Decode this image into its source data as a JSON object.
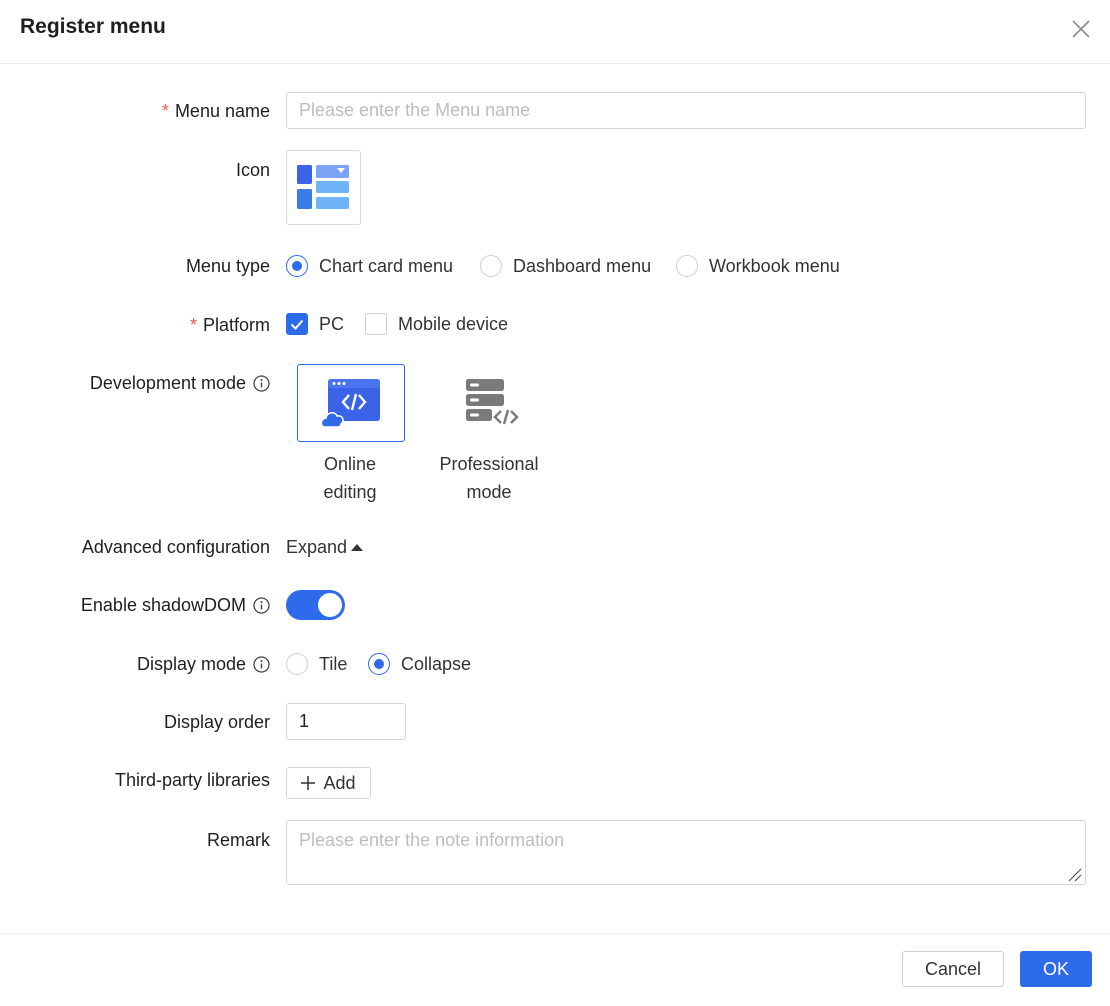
{
  "dialog": {
    "title": "Register menu"
  },
  "form": {
    "menu_name": {
      "label": "Menu name",
      "required_mark": "*",
      "value": "",
      "placeholder": "Please enter the Menu name"
    },
    "icon": {
      "label": "Icon",
      "icon_name": "table-layout-icon"
    },
    "menu_type": {
      "label": "Menu type",
      "options": [
        {
          "label": "Chart card menu",
          "selected": true
        },
        {
          "label": "Dashboard menu",
          "selected": false
        },
        {
          "label": "Workbook menu",
          "selected": false
        }
      ]
    },
    "platform": {
      "label": "Platform",
      "required_mark": "*",
      "options": [
        {
          "label": "PC",
          "checked": true
        },
        {
          "label": "Mobile device",
          "checked": false
        }
      ]
    },
    "development_mode": {
      "label": "Development mode",
      "options": [
        {
          "label_line1": "Online",
          "label_line2": "editing",
          "icon_name": "cloud-code-window-icon",
          "selected": true
        },
        {
          "label_line1": "Professional",
          "label_line2": "mode",
          "icon_name": "server-code-icon",
          "selected": false
        }
      ]
    },
    "advanced_configuration": {
      "label": "Advanced configuration",
      "toggle_text": "Expand"
    },
    "enable_shadowdom": {
      "label": "Enable shadowDOM",
      "on": true
    },
    "display_mode": {
      "label": "Display mode",
      "options": [
        {
          "label": "Tile",
          "selected": false
        },
        {
          "label": "Collapse",
          "selected": true
        }
      ]
    },
    "display_order": {
      "label": "Display order",
      "value": "1"
    },
    "third_party_libraries": {
      "label": "Third-party libraries",
      "add_label": "Add"
    },
    "remark": {
      "label": "Remark",
      "value": "",
      "placeholder": "Please enter the note information"
    }
  },
  "footer": {
    "cancel_label": "Cancel",
    "ok_label": "OK"
  },
  "colors": {
    "primary": "#2e6bea",
    "required": "#f5574a",
    "border": "#d6d6d6",
    "placeholder": "#bdbdbd"
  }
}
